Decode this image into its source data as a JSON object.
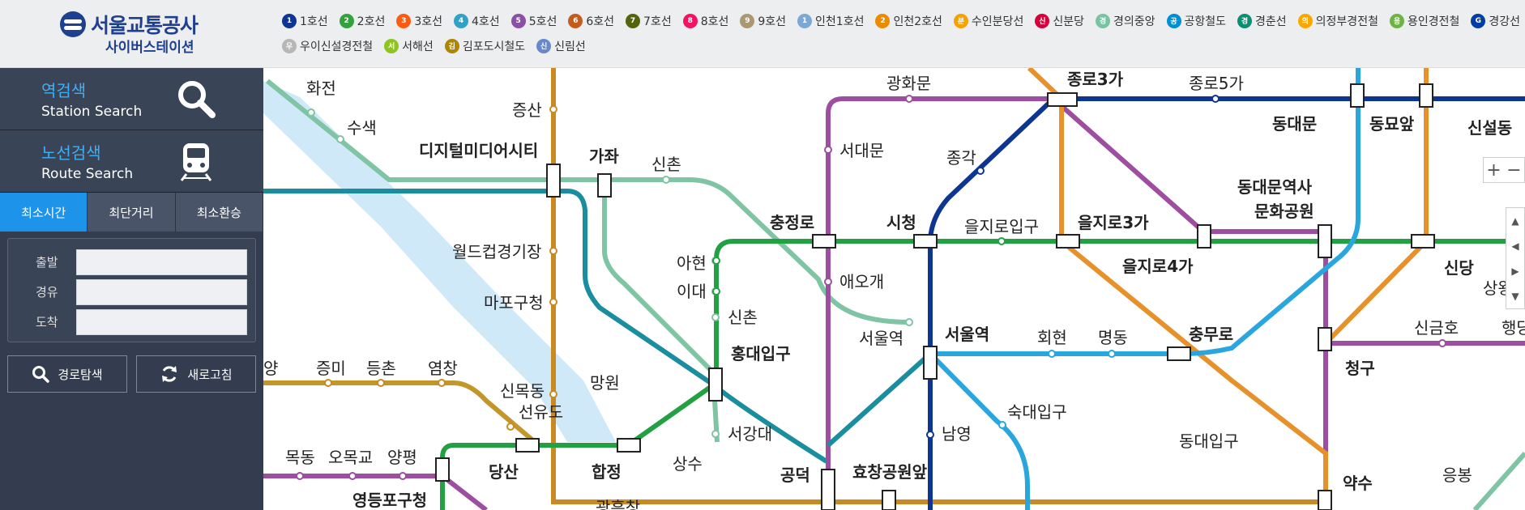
{
  "logo": {
    "name": "서울교통공사",
    "sub": "사이버스테이션"
  },
  "legend": {
    "row1": [
      {
        "badge": "1",
        "label": "1호선",
        "color": "#0d3692"
      },
      {
        "badge": "2",
        "label": "2호선",
        "color": "#33a23d"
      },
      {
        "badge": "3",
        "label": "3호선",
        "color": "#fe5b10"
      },
      {
        "badge": "4",
        "label": "4호선",
        "color": "#32a1c8"
      },
      {
        "badge": "5",
        "label": "5호선",
        "color": "#8b50a4"
      },
      {
        "badge": "6",
        "label": "6호선",
        "color": "#c55c1d"
      },
      {
        "badge": "7",
        "label": "7호선",
        "color": "#54640d"
      },
      {
        "badge": "8",
        "label": "8호선",
        "color": "#f51361"
      },
      {
        "badge": "9",
        "label": "9호선",
        "color": "#aa9872"
      },
      {
        "badge": "1",
        "label": "인천1호선",
        "color": "#7ca8d5"
      },
      {
        "badge": "2",
        "label": "인천2호선",
        "color": "#ed8b00"
      },
      {
        "badge": "분",
        "label": "수인분당선",
        "color": "#f5a200"
      },
      {
        "badge": "신",
        "label": "신분당",
        "color": "#d4003b"
      },
      {
        "badge": "경",
        "label": "경의중앙",
        "color": "#77c4a3"
      },
      {
        "badge": "공",
        "label": "공항철도",
        "color": "#0090d2"
      },
      {
        "badge": "경",
        "label": "경춘선",
        "color": "#0c8e72"
      },
      {
        "badge": "의",
        "label": "의정부경전철",
        "color": "#fda600"
      },
      {
        "badge": "용",
        "label": "용인경전철",
        "color": "#6fb245"
      },
      {
        "badge": "G",
        "label": "경강선",
        "color": "#003da5"
      }
    ],
    "row2": [
      {
        "badge": "우",
        "label": "우이신설경전철",
        "color": "#b7b7b7"
      },
      {
        "badge": "서",
        "label": "서해선",
        "color": "#8fc31f"
      },
      {
        "badge": "김",
        "label": "김포도시철도",
        "color": "#ad8605"
      },
      {
        "badge": "신",
        "label": "신림선",
        "color": "#6789ca"
      }
    ]
  },
  "sidebar": {
    "station_search": {
      "ko": "역검색",
      "en": "Station Search"
    },
    "route_search": {
      "ko": "노선검색",
      "en": "Route Search"
    },
    "tabs": [
      "최소시간",
      "최단거리",
      "최소환승"
    ],
    "fields": [
      "출발",
      "경유",
      "도착"
    ],
    "search_btn": "경로탐색",
    "refresh_btn": "새로고침"
  },
  "map": {
    "zoom_in": "+",
    "zoom_out": "−",
    "stations": {
      "hwajeon": "화전",
      "susaek": "수색",
      "dmc": "디지털미디어시티",
      "jeungsan": "증산",
      "gajwa": "가좌",
      "sinchon_gy": "신촌",
      "gwanghwamun": "광화문",
      "jongno3": "종로3가",
      "jongno5": "종로5가",
      "dongdaemun": "동대문",
      "dongmyo": "동묘앞",
      "sinseol": "신설동",
      "seodaemun": "서대문",
      "jonggak": "종각",
      "ddp1": "동대문역사",
      "ddp2": "문화공원",
      "chungjeongno": "충정로",
      "cityhall": "시청",
      "euljiro1": "을지로입구",
      "euljiro3": "을지로3가",
      "euljiro4": "을지로4가",
      "sindang": "신당",
      "sangwangsimni": "상왕십",
      "worldcup": "월드컵경기장",
      "ahyeon": "아현",
      "idae": "이대",
      "sinchon2": "신촌",
      "aeogae": "애오개",
      "mapogu": "마포구청",
      "seoulyeok": "서울역",
      "seoulstation": "서울역",
      "hoehyeon": "회현",
      "myeongdong": "명동",
      "chungmuro": "충무로",
      "singeumho": "신금호",
      "haengdang": "행당",
      "hongik": "홍대입구",
      "cheonggu": "청구",
      "yang": "양",
      "jeungmi": "증미",
      "deungchon": "등촌",
      "yeomchang": "염창",
      "sinmokdong": "신목동",
      "mangwon": "망원",
      "seonyudo": "선유도",
      "sookmyung": "숙대입구",
      "seogangdae": "서강대",
      "namyeong": "남영",
      "dongguk": "동대입구",
      "mokdong": "목동",
      "omokgyo": "오목교",
      "yangpyeong": "양평",
      "dangsan": "당산",
      "hapjeong": "합정",
      "sangsu": "상수",
      "gongdeok": "공덕",
      "hyochang": "효창공원앞",
      "yaksu": "약수",
      "eungbong": "응봉",
      "yeongdeungpo": "영등포구청",
      "gwangheungchang": "광흥창"
    }
  }
}
